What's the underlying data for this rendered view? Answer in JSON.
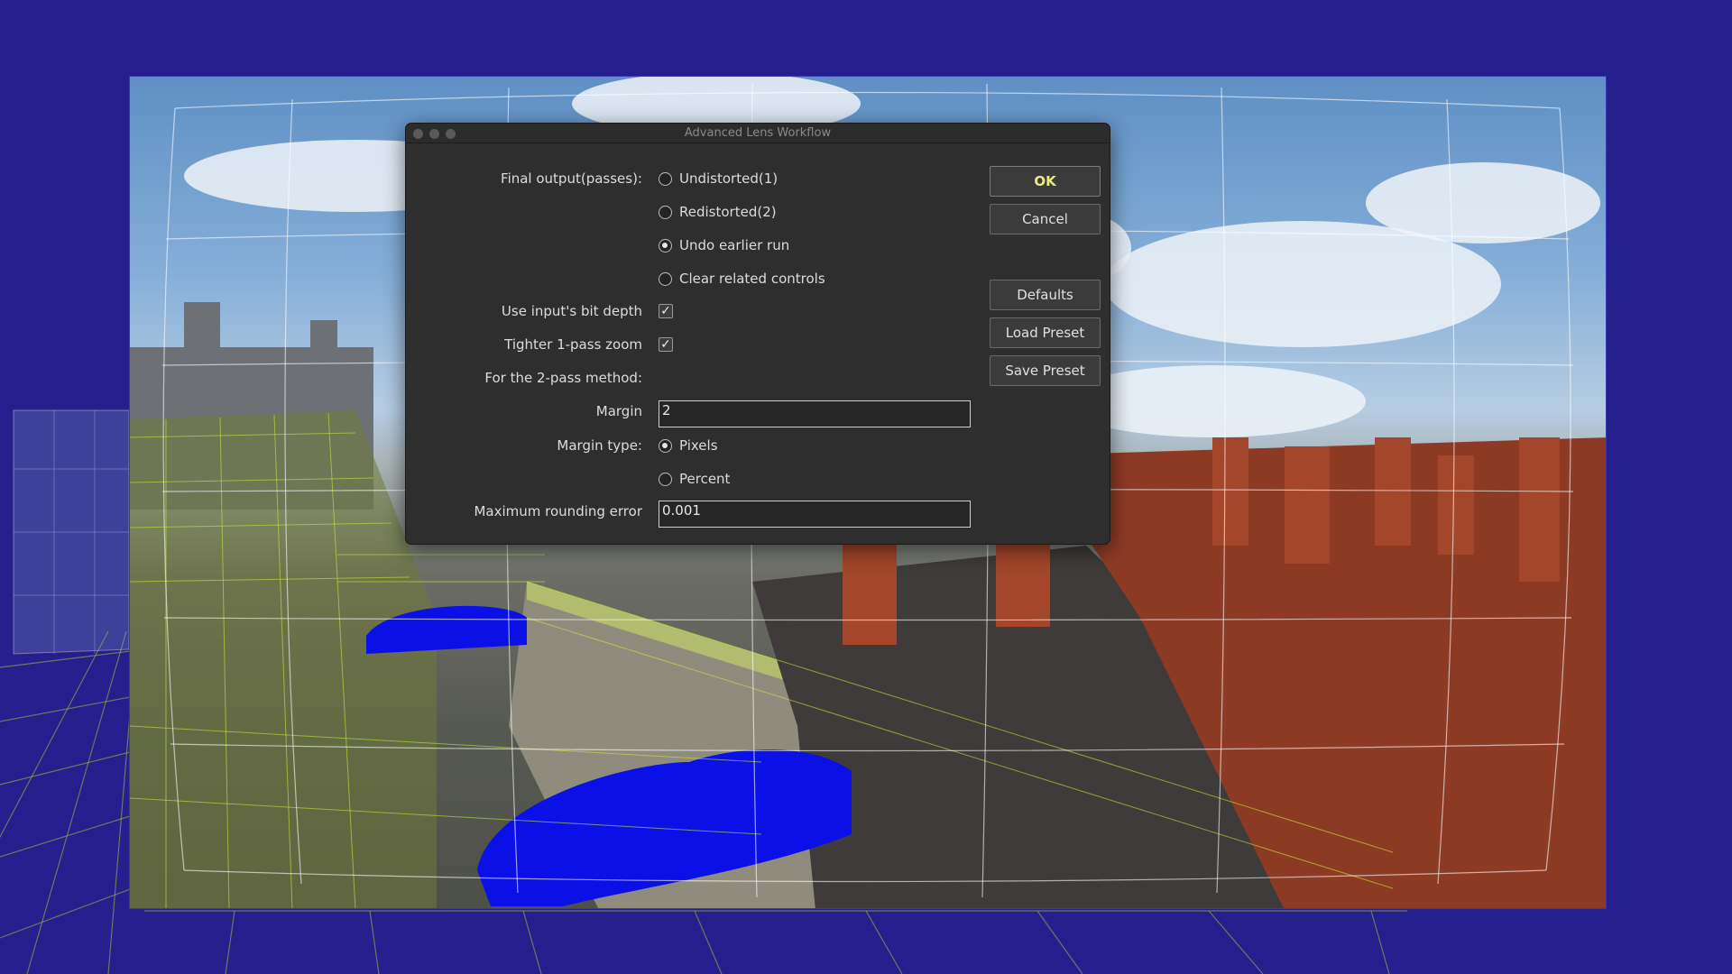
{
  "dialog": {
    "title": "Advanced Lens Workflow",
    "final_output": {
      "label": "Final output(passes):",
      "options": [
        "Undistorted(1)",
        "Redistorted(2)",
        "Undo earlier run",
        "Clear related controls"
      ],
      "selected": "Undo earlier run"
    },
    "bit_depth": {
      "label": "Use input's bit depth",
      "checked": true
    },
    "tighter_zoom": {
      "label": "Tighter 1-pass zoom",
      "checked": true
    },
    "two_pass_heading": "For the 2-pass method:",
    "margin": {
      "label": "Margin",
      "value": "2"
    },
    "margin_type": {
      "label": "Margin type:",
      "options": [
        "Pixels",
        "Percent"
      ],
      "selected": "Pixels"
    },
    "max_rounding": {
      "label": "Maximum rounding error",
      "value": "0.001"
    },
    "buttons": {
      "ok": "OK",
      "cancel": "Cancel",
      "defaults": "Defaults",
      "load_preset": "Load Preset",
      "save_preset": "Save Preset"
    }
  },
  "colors": {
    "backdrop": "#241f8c",
    "grid_lime": "#c6e83c",
    "car_blue": "#0a10e6",
    "ok_text": "#ecec7c"
  }
}
